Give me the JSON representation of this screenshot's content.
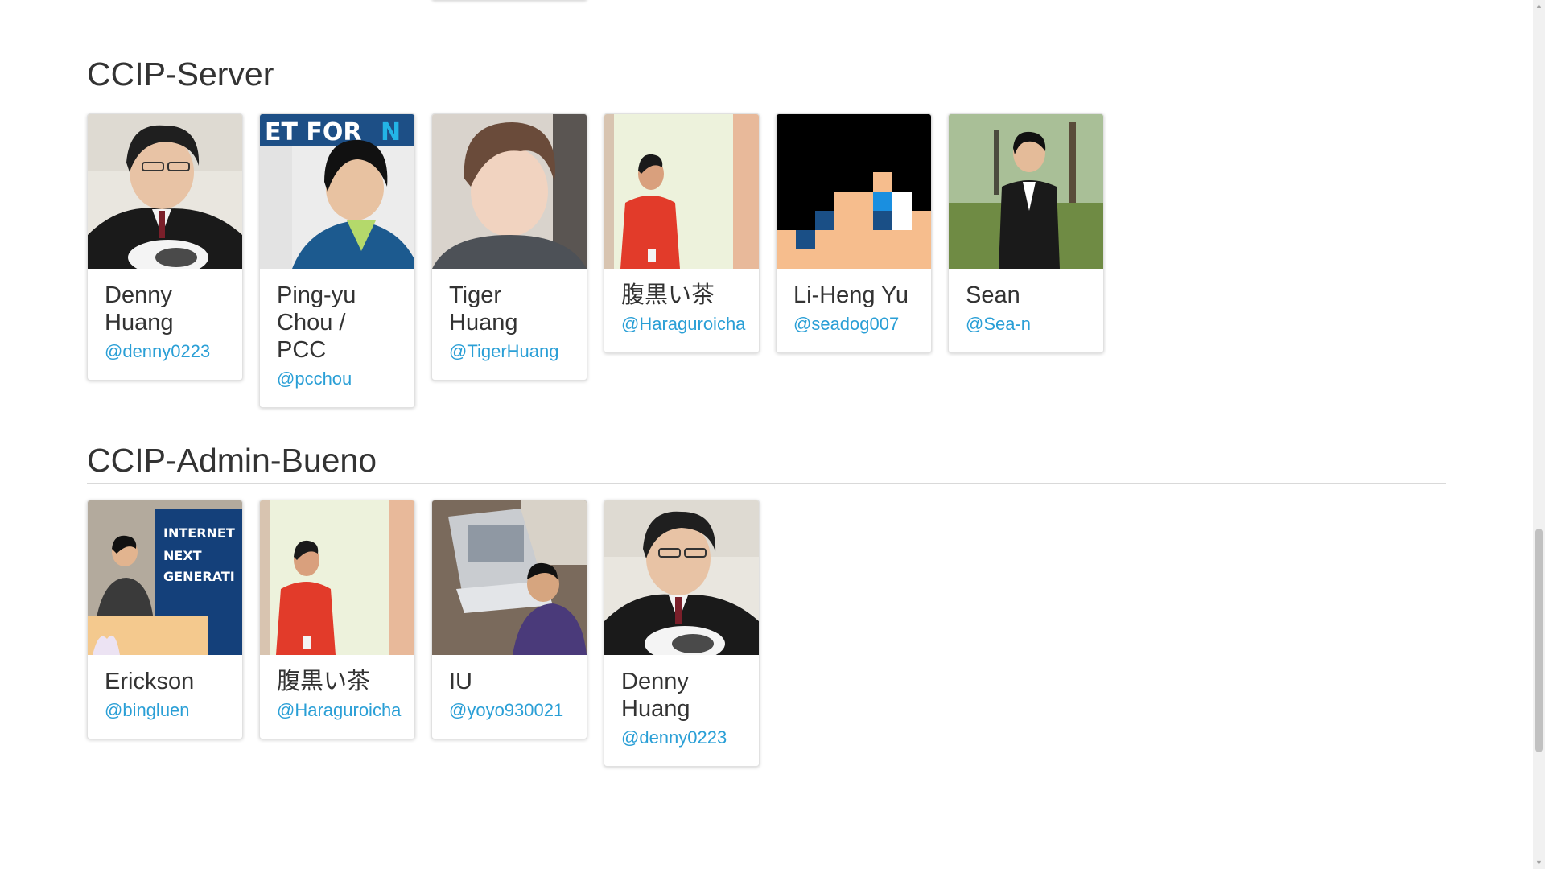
{
  "sections": [
    {
      "title": "CCIP-Server",
      "members": [
        {
          "name": "Denny Huang",
          "handle": "@denny0223",
          "photo": "denny-photo"
        },
        {
          "name": "Ping-yu Chou / PCC",
          "handle": "@pcchou",
          "photo": "pcchou-photo"
        },
        {
          "name": "Tiger Huang",
          "handle": "@TigerHuang",
          "photo": "tiger-photo"
        },
        {
          "name": "腹黒い茶",
          "handle": "@Haraguroicha",
          "photo": "haraguroicha-photo"
        },
        {
          "name": "Li-Heng Yu",
          "handle": "@seadog007",
          "photo": "pixel-art-photo"
        },
        {
          "name": "Sean",
          "handle": "@Sea-n",
          "photo": "sean-photo"
        }
      ]
    },
    {
      "title": "CCIP-Admin-Bueno",
      "members": [
        {
          "name": "Erickson",
          "handle": "@bingluen",
          "photo": "erickson-photo"
        },
        {
          "name": "腹黒い茶",
          "handle": "@Haraguroicha",
          "photo": "haraguroicha-photo"
        },
        {
          "name": "IU",
          "handle": "@yoyo930021",
          "photo": "iu-photo"
        },
        {
          "name": "Denny Huang",
          "handle": "@denny0223",
          "photo": "denny-photo"
        }
      ]
    }
  ],
  "colors": {
    "link": "#2a9fd6",
    "text": "#333333",
    "border": "#e1e1e1"
  }
}
